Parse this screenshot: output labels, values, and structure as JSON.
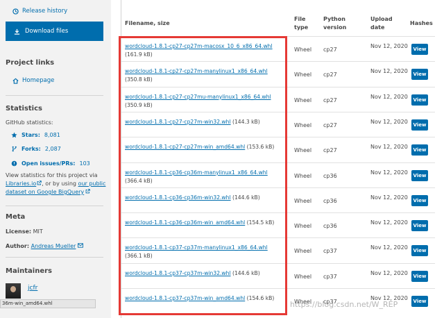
{
  "sidebar": {
    "release_history": "Release history",
    "download_files": "Download files",
    "project_links_heading": "Project links",
    "homepage": "Homepage",
    "statistics_heading": "Statistics",
    "github_statistics": "GitHub statistics:",
    "stars_label": "Stars:",
    "stars_value": "8,081",
    "forks_label": "Forks:",
    "forks_value": "2,087",
    "issues_label": "Open issues/PRs:",
    "issues_value": "103",
    "view_stats_text": "View statistics for this project via",
    "libraries_link": "Libraries.io",
    "or_using_text": ", or by using",
    "bigquery_link_1": "our public",
    "bigquery_link_2": "dataset on Google BigQuery",
    "meta_heading": "Meta",
    "license_label": "License:",
    "license_value": "MIT",
    "author_label": "Author:",
    "author_value": "Andreas Mueller",
    "maintainers_heading": "Maintainers",
    "maintainer_name": "jcfr",
    "status_bar_text": "36m-win_amd64.whl"
  },
  "table": {
    "headers": {
      "filename": "Filename, size",
      "filetype": "File type",
      "python_version": "Python version",
      "upload_date": "Upload date",
      "hashes": "Hashes"
    },
    "rows": [
      {
        "filename": "wordcloud-1.8.1-cp27-cp27m-macosx_10_6_x86_64.whl",
        "size": "(161.9 kB)",
        "type": "Wheel",
        "python": "cp27",
        "date": "Nov 12, 2020",
        "button": "View"
      },
      {
        "filename": "wordcloud-1.8.1-cp27-cp27m-manylinux1_x86_64.whl",
        "size": "(350.8 kB)",
        "type": "Wheel",
        "python": "cp27",
        "date": "Nov 12, 2020",
        "button": "View"
      },
      {
        "filename": "wordcloud-1.8.1-cp27-cp27mu-manylinux1_x86_64.whl",
        "size": "(350.9 kB)",
        "type": "Wheel",
        "python": "cp27",
        "date": "Nov 12, 2020",
        "button": "View"
      },
      {
        "filename": "wordcloud-1.8.1-cp27-cp27m-win32.whl",
        "size": "(144.3 kB)",
        "type": "Wheel",
        "python": "cp27",
        "date": "Nov 12, 2020",
        "button": "View"
      },
      {
        "filename": "wordcloud-1.8.1-cp27-cp27m-win_amd64.whl",
        "size": "(153.6 kB)",
        "type": "Wheel",
        "python": "cp27",
        "date": "Nov 12, 2020",
        "button": "View"
      },
      {
        "filename": "wordcloud-1.8.1-cp36-cp36m-manylinux1_x86_64.whl",
        "size": "(366.4 kB)",
        "type": "Wheel",
        "python": "cp36",
        "date": "Nov 12, 2020",
        "button": "View"
      },
      {
        "filename": "wordcloud-1.8.1-cp36-cp36m-win32.whl",
        "size": "(144.6 kB)",
        "type": "Wheel",
        "python": "cp36",
        "date": "Nov 12, 2020",
        "button": "View"
      },
      {
        "filename": "wordcloud-1.8.1-cp36-cp36m-win_amd64.whl",
        "size": "(154.5 kB)",
        "type": "Wheel",
        "python": "cp36",
        "date": "Nov 12, 2020",
        "button": "View"
      },
      {
        "filename": "wordcloud-1.8.1-cp37-cp37m-manylinux1_x86_64.whl",
        "size": "(366.1 kB)",
        "type": "Wheel",
        "python": "cp37",
        "date": "Nov 12, 2020",
        "button": "View"
      },
      {
        "filename": "wordcloud-1.8.1-cp37-cp37m-win32.whl",
        "size": "(144.6 kB)",
        "type": "Wheel",
        "python": "cp37",
        "date": "Nov 12, 2020",
        "button": "View"
      },
      {
        "filename": "wordcloud-1.8.1-cp37-cp37m-win_amd64.whl",
        "size": "(154.6 kB)",
        "type": "Wheel",
        "python": "cp37",
        "date": "Nov 12, 2020",
        "button": "View"
      }
    ]
  },
  "watermark": "https://blog.csdn.net/W_REP",
  "colors": {
    "accent": "#006dad",
    "highlight": "#e53935",
    "sidebar_bg": "#f2f2f2"
  },
  "icons": [
    "history-icon",
    "download-icon",
    "home-icon",
    "star-icon",
    "fork-icon",
    "issue-icon",
    "external-link-icon",
    "envelope-icon"
  ]
}
